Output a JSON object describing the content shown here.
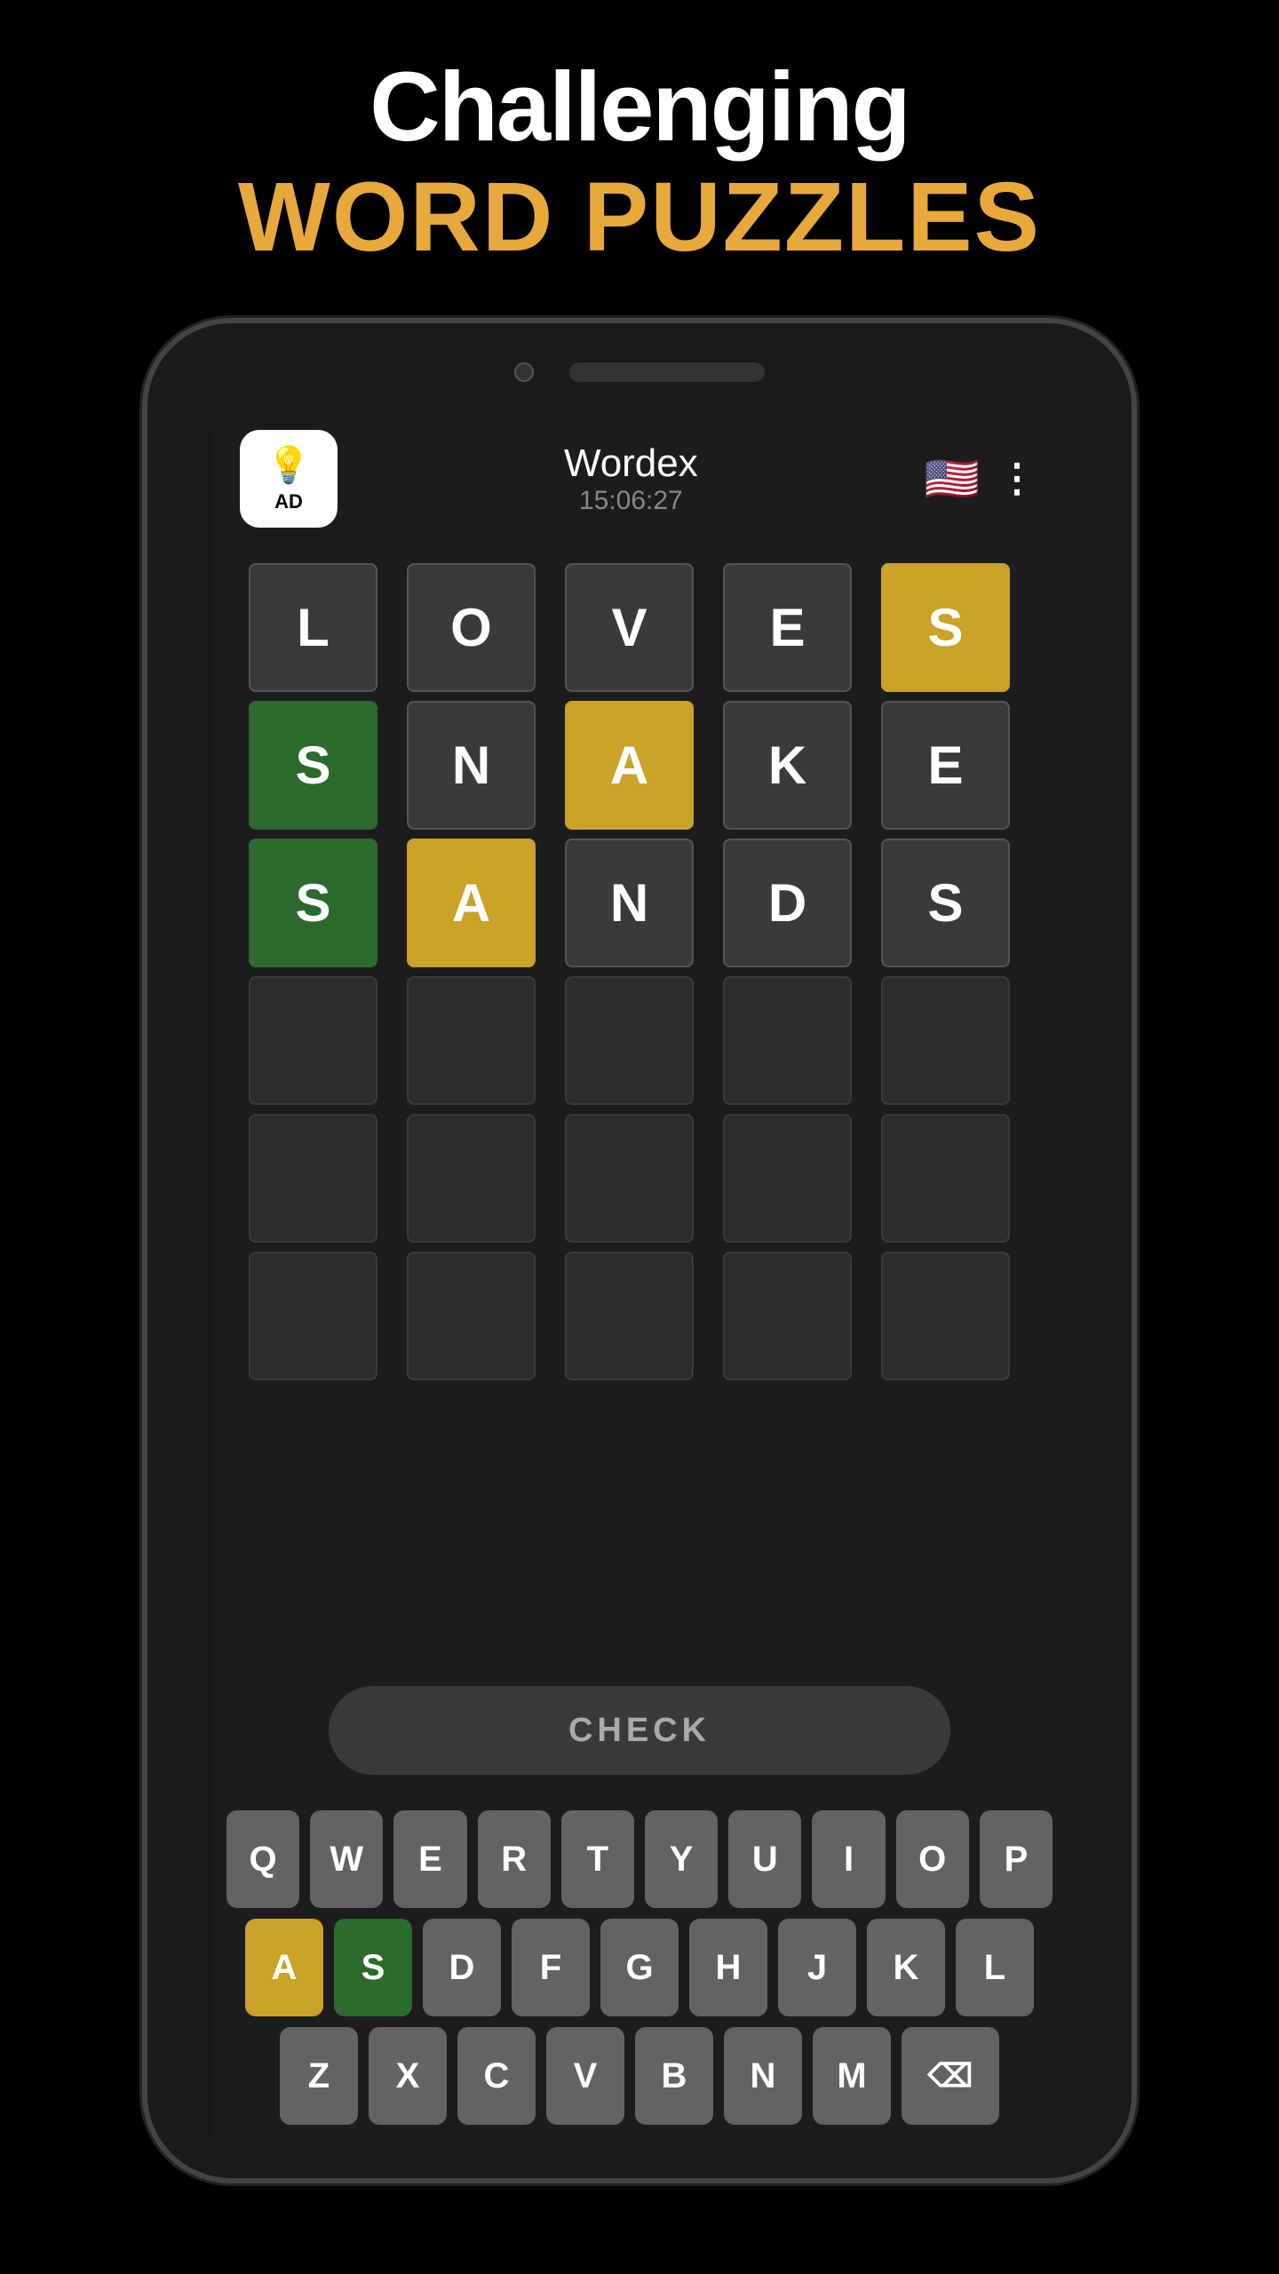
{
  "hero": {
    "title": "Challenging",
    "subtitle": "WORD PUZZLES"
  },
  "app": {
    "ad_label": "AD",
    "title": "Wordex",
    "timer": "15:06:27",
    "check_label": "CHECK"
  },
  "grid": {
    "rows": [
      [
        {
          "letter": "L",
          "state": "empty"
        },
        {
          "letter": "O",
          "state": "empty"
        },
        {
          "letter": "V",
          "state": "empty"
        },
        {
          "letter": "E",
          "state": "empty"
        },
        {
          "letter": "S",
          "state": "yellow"
        }
      ],
      [
        {
          "letter": "S",
          "state": "green"
        },
        {
          "letter": "N",
          "state": "empty"
        },
        {
          "letter": "A",
          "state": "yellow"
        },
        {
          "letter": "K",
          "state": "empty"
        },
        {
          "letter": "E",
          "state": "empty"
        }
      ],
      [
        {
          "letter": "S",
          "state": "green"
        },
        {
          "letter": "A",
          "state": "yellow"
        },
        {
          "letter": "N",
          "state": "empty"
        },
        {
          "letter": "D",
          "state": "empty"
        },
        {
          "letter": "S",
          "state": "empty"
        }
      ],
      [
        {
          "letter": "",
          "state": "blank"
        },
        {
          "letter": "",
          "state": "blank"
        },
        {
          "letter": "",
          "state": "blank"
        },
        {
          "letter": "",
          "state": "blank"
        },
        {
          "letter": "",
          "state": "blank"
        }
      ],
      [
        {
          "letter": "",
          "state": "blank"
        },
        {
          "letter": "",
          "state": "blank"
        },
        {
          "letter": "",
          "state": "blank"
        },
        {
          "letter": "",
          "state": "blank"
        },
        {
          "letter": "",
          "state": "blank"
        }
      ],
      [
        {
          "letter": "",
          "state": "blank"
        },
        {
          "letter": "",
          "state": "blank"
        },
        {
          "letter": "",
          "state": "blank"
        },
        {
          "letter": "",
          "state": "blank"
        },
        {
          "letter": "",
          "state": "blank"
        }
      ]
    ]
  },
  "keyboard": {
    "rows": [
      [
        "Q",
        "W",
        "E",
        "R",
        "T",
        "Y",
        "U",
        "I",
        "O",
        "P"
      ],
      [
        "A",
        "S",
        "D",
        "F",
        "G",
        "H",
        "J",
        "K",
        "L"
      ],
      [
        "Z",
        "X",
        "C",
        "V",
        "B",
        "N",
        "M",
        "⌫"
      ]
    ],
    "yellow_keys": [
      "A"
    ],
    "green_keys": [
      "S"
    ]
  }
}
